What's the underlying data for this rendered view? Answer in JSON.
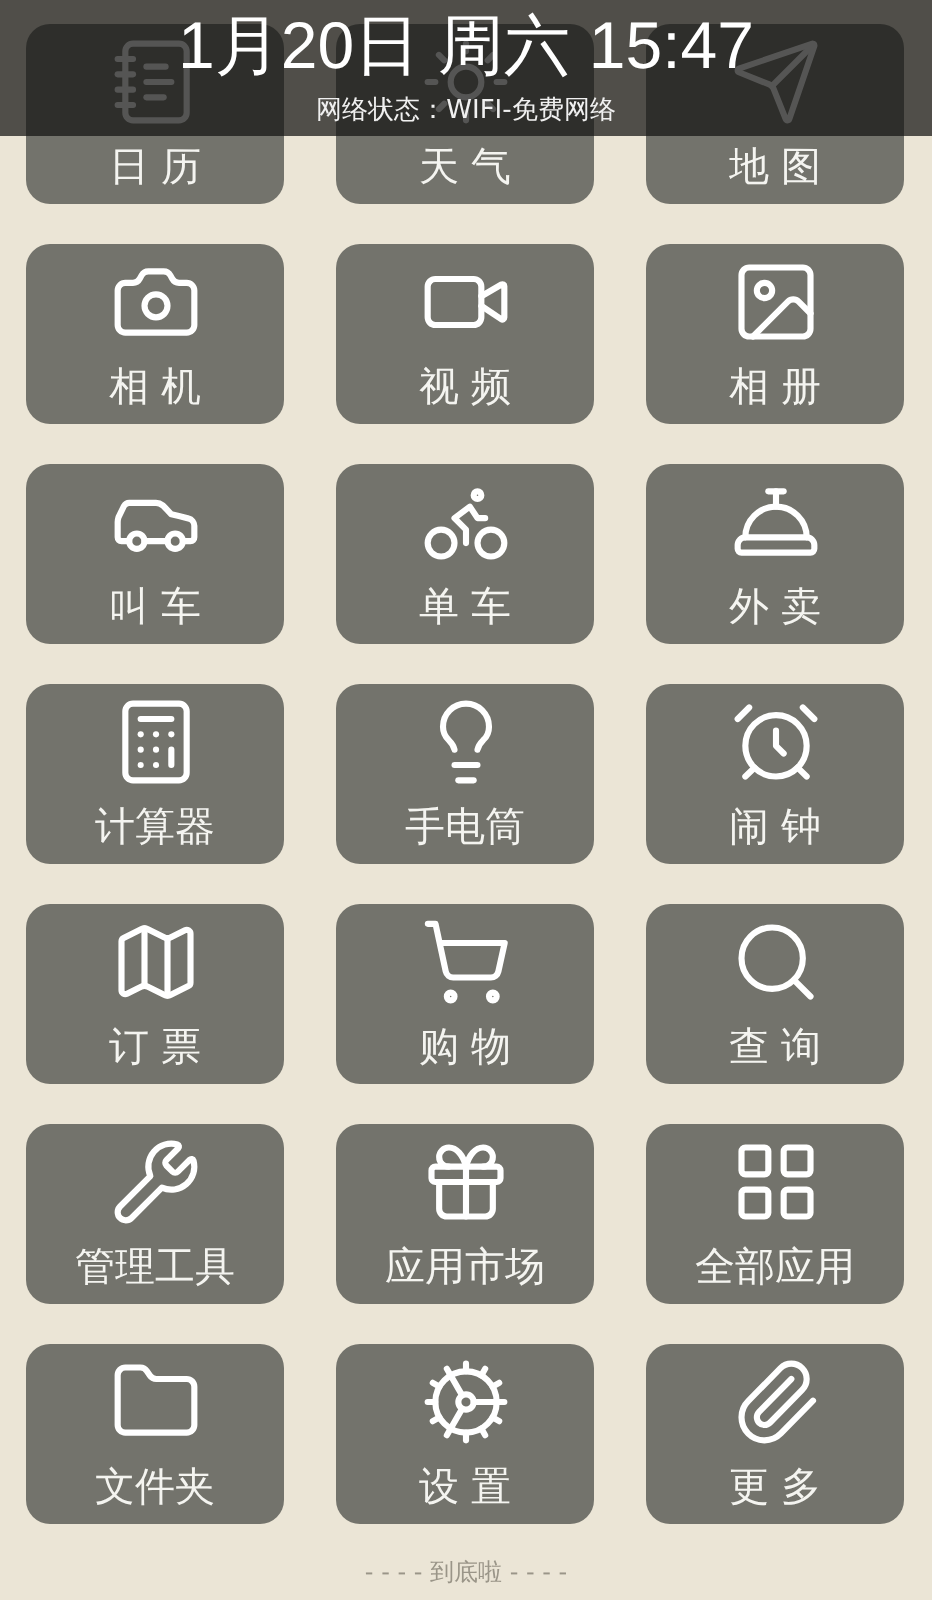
{
  "header": {
    "datetime": "1月20日 周六 15:47",
    "network": "网络状态：WIFI-免费网络"
  },
  "apps": [
    {
      "label": "日 历"
    },
    {
      "label": "天 气"
    },
    {
      "label": "地 图"
    },
    {
      "label": "相 机"
    },
    {
      "label": "视 频"
    },
    {
      "label": "相 册"
    },
    {
      "label": "叫 车"
    },
    {
      "label": "单 车"
    },
    {
      "label": "外 卖"
    },
    {
      "label": "计算器"
    },
    {
      "label": "手电筒"
    },
    {
      "label": "闹 钟"
    },
    {
      "label": "订 票"
    },
    {
      "label": "购 物"
    },
    {
      "label": "查 询"
    },
    {
      "label": "管理工具"
    },
    {
      "label": "应用市场"
    },
    {
      "label": "全部应用"
    },
    {
      "label": "文件夹"
    },
    {
      "label": "设 置"
    },
    {
      "label": "更 多"
    }
  ],
  "footer": "- - - - 到底啦 - - - -"
}
